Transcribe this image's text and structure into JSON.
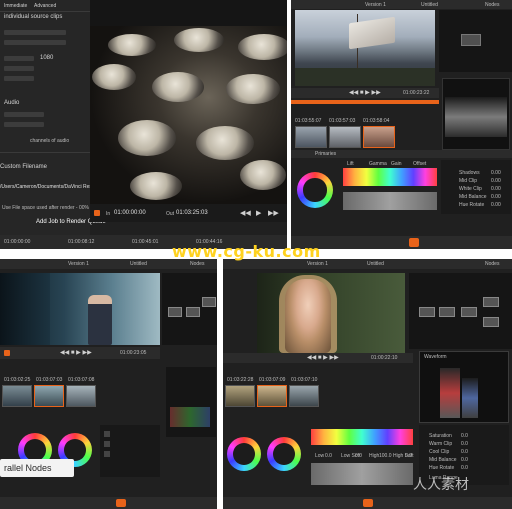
{
  "top_left": {
    "tabs": [
      "Immediate",
      "Advanced"
    ],
    "sidebar_lines": [
      "individual source clips",
      "Audio",
      "channels of audio",
      "Custom Filename",
      "/Users/Cameron/Documents/DaVinci Resolve",
      "Use File space used after render - 00%"
    ],
    "width_value": "1080",
    "add_job_button": "Add Job to Render Queue",
    "timecode_in_label": "In",
    "timecode_in": "01:00:00:00",
    "timecode_out_label": "Out",
    "timecode_out": "01:03:25:03",
    "bottom_times": [
      "01:00:00:00",
      "01:00:08:12",
      "01:00:45:01",
      "01:00:44:16"
    ]
  },
  "top_right": {
    "tabs": [
      "Version 1",
      "Untitled",
      "Nodes"
    ],
    "timecode": "01:00:23:22",
    "clip_times": [
      "01:03:55:07",
      "01:03:57:03",
      "01:03:58:04"
    ],
    "panel_title": "Primaries",
    "params": [
      "Shadows",
      "Mid Clip",
      "White Clip",
      "Mid Balance",
      "Hue Rotate"
    ],
    "param_values": [
      "0.00",
      "0.00",
      "0.00",
      "0.00",
      "0.00"
    ],
    "lift_labels": [
      "Lift",
      "Gamma",
      "Gain",
      "Offset"
    ]
  },
  "bottom_left": {
    "tabs": [
      "Version 1",
      "Untitled",
      "Nodes"
    ],
    "timecode": "01:00:23:05",
    "clip_times": [
      "01:03:02:25",
      "01:03:07:03",
      "01:03:07:08"
    ],
    "overlay_label": "rallel Nodes"
  },
  "bottom_right": {
    "tabs": [
      "Version 1",
      "Untitled",
      "Nodes"
    ],
    "timecode": "01:00:22:10",
    "clip_times": [
      "01:03:22:28",
      "01:03:07:09",
      "01:03:07:10"
    ],
    "scope_title": "Waveform",
    "params": [
      "Saturation",
      "Warm Clip",
      "Cool Clip",
      "Mid Balance",
      "Hue Rotate"
    ],
    "param_values": [
      "0.0",
      "0.0",
      "0.0",
      "0.0",
      "0.0"
    ],
    "hsl_labels": [
      "Low",
      "Low Soft",
      "High",
      "High Soft"
    ],
    "hsl_values": [
      "0.0",
      "0.0",
      "100.0",
      "0.0"
    ],
    "curves_label": "Luma Range"
  },
  "watermarks": {
    "url": "www.cg-ku.com",
    "site_cn": "人人素材"
  },
  "colors": {
    "panel_bg": "#202020",
    "watermark_yellow": "#ffd21f",
    "playhead_orange": "#e8631a"
  }
}
